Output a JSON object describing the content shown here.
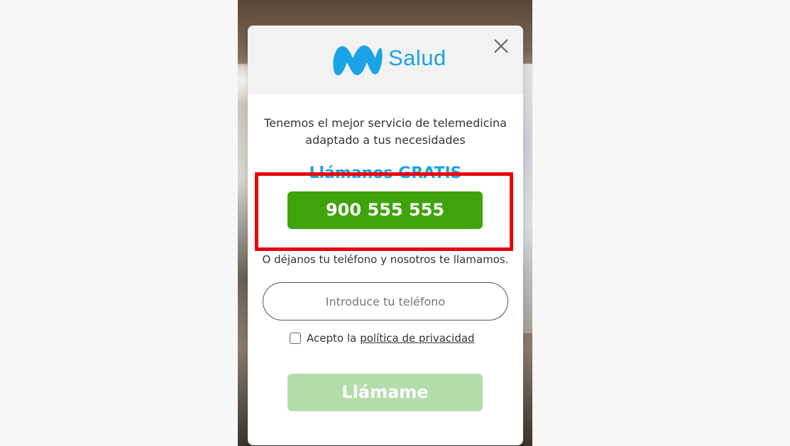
{
  "brand": {
    "name": "Salud",
    "logo_icon": "movistar-m-logo",
    "color": "#1aa3e6"
  },
  "header": {
    "close_icon": "close-icon"
  },
  "intro": {
    "line1": "Tenemos el mejor servicio de telemedicina",
    "line2": "adaptado a tus necesidades"
  },
  "call": {
    "title": "Llámanos GRATIS",
    "phone_number": "900 555 555",
    "button_color": "#3fa30b"
  },
  "callback": {
    "text": "O déjanos tu teléfono y nosotros te llamamos.",
    "input_placeholder": "Introduce tu teléfono",
    "input_value": ""
  },
  "privacy": {
    "checkbox_checked": false,
    "prefix": "Acepto la",
    "link_text": "política de privacidad"
  },
  "submit": {
    "label": "Llámame",
    "button_color": "#b5dcab"
  },
  "annotation": {
    "highlight_color": "#e8060b"
  }
}
